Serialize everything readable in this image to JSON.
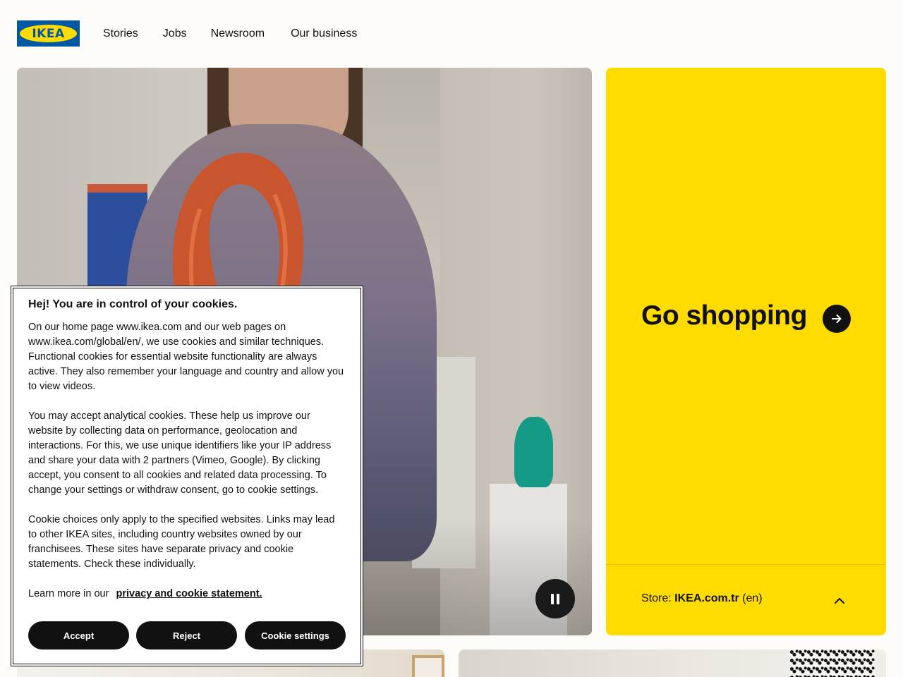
{
  "header": {
    "logo_text": "IKEA",
    "nav": [
      "Stories",
      "Jobs",
      "Newsroom",
      "Our business"
    ]
  },
  "hero": {
    "pause_icon": "pause-icon"
  },
  "promo": {
    "title": "Go shopping",
    "arrow_icon": "arrow-right-icon",
    "store_label": "Store:",
    "store_name": "IKEA.com.tr",
    "store_lang": "(en)",
    "chevron_icon": "chevron-up-icon"
  },
  "cookie": {
    "title": "Hej! You are in control of your cookies.",
    "p1": "On our home page www.ikea.com and our web pages on www.ikea.com/global/en/, we use cookies and similar techniques. Functional cookies for essential website functionality are always active. They also remember your language and country and allow you to view videos.",
    "p2": "You may accept analytical cookies. These help us improve our website by collecting data on performance, geolocation and interactions. For this, we use unique identifiers like your IP address and share your data with 2 partners (Vimeo, Google). By clicking accept, you consent to all cookies and related data processing. To change your settings or withdraw consent, go to cookie settings.",
    "p3": "Cookie choices only apply to the specified websites. Links may lead to other IKEA sites, including country websites owned by our franchisees. These sites have separate privacy and cookie statements. Check these individually.",
    "learn_more": "Learn more in our",
    "privacy_link": "privacy and cookie statement.",
    "accept": "Accept",
    "reject": "Reject",
    "settings": "Cookie settings"
  },
  "colors": {
    "brand_blue": "#0058a3",
    "brand_yellow": "#ffdb00",
    "button_dark": "#111111",
    "page_bg": "#fdfcf8"
  }
}
